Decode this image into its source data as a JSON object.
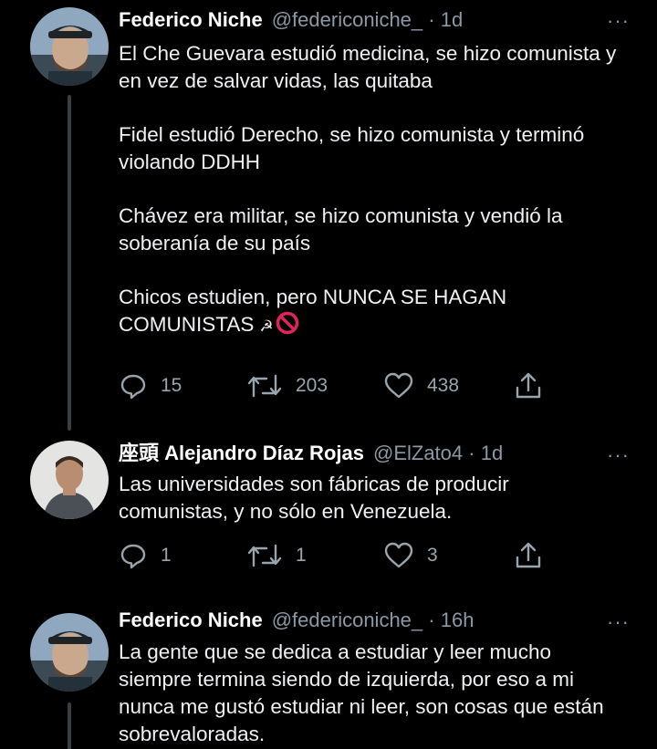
{
  "tweets": [
    {
      "name": "Federico Niche",
      "handle": "@federiconiche_",
      "time": "· 1d",
      "more": "···",
      "paragraphs": [
        "El Che Guevara estudió medicina, se hizo comunista y en vez de salvar vidas, las quitaba",
        "Fidel estudió Derecho, se hizo comunista y terminó violando DDHH",
        "Chávez era militar, se hizo comunista y vendió la soberanía de su país",
        "Chicos estudien, pero NUNCA SE HAGAN COMUNISTAS"
      ],
      "emoji": {
        "hammer_sickle": "☭",
        "prohibited_color": "#e0245e"
      },
      "replies": "15",
      "retweets": "203",
      "likes": "438"
    },
    {
      "name_prefix": "座頭",
      "name": "Alejandro Díaz Rojas",
      "handle": "@ElZato4",
      "time": "· 1d",
      "more": "···",
      "paragraphs": [
        "Las universidades son fábricas de producir comunistas, y no sólo en Venezuela."
      ],
      "replies": "1",
      "retweets": "1",
      "likes": "3"
    },
    {
      "name": "Federico Niche",
      "handle": "@federiconiche_",
      "time": "· 16h",
      "more": "···",
      "paragraphs": [
        "La gente que se dedica a estudiar y leer mucho siempre termina siendo de izquierda, por eso a mi nunca me gustó estudiar ni leer, son cosas que están sobrevaloradas."
      ]
    }
  ],
  "colors": {
    "background": "#000000",
    "text": "#e7e9ea",
    "secondary": "#8b98a5",
    "thread_line": "#3a3d41"
  }
}
